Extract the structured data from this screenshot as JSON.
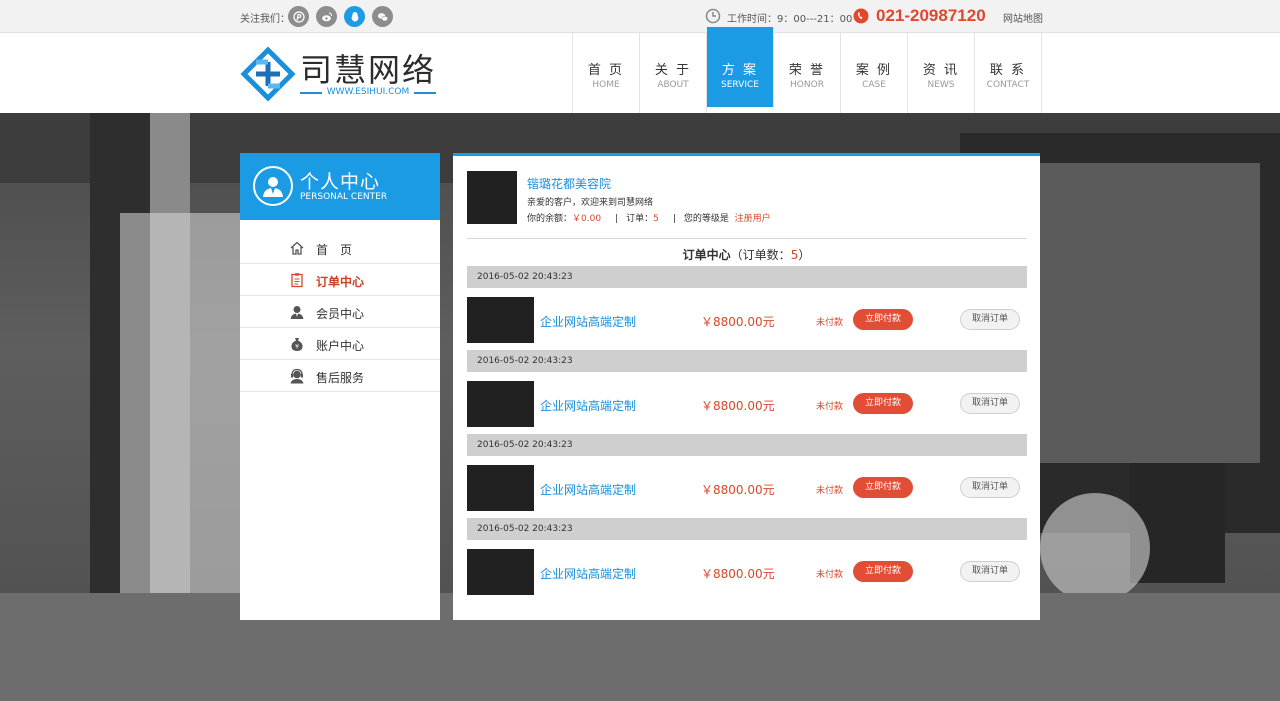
{
  "topbar": {
    "follow_label": "关注我们：",
    "hours": "工作时间：9：00---21：00",
    "phone": "021-20987120",
    "sitemap": "网站地图"
  },
  "header": {
    "logo_text": "司慧网络",
    "logo_url": "WWW.ESIHUI.COM"
  },
  "nav": [
    {
      "zh": "首 页",
      "en": "HOME"
    },
    {
      "zh": "关 于",
      "en": "ABOUT"
    },
    {
      "zh": "方 案",
      "en": "SERVICE"
    },
    {
      "zh": "荣 誉",
      "en": "HONOR"
    },
    {
      "zh": "案 例",
      "en": "CASE"
    },
    {
      "zh": "资 讯",
      "en": "NEWS"
    },
    {
      "zh": "联 系",
      "en": "CONTACT"
    }
  ],
  "sidebar": {
    "title": "个人中心",
    "subtitle": "PERSONAL CENTER",
    "items": [
      {
        "label": "首　页",
        "icon": "home-icon"
      },
      {
        "label": "订单中心",
        "icon": "clipboard-icon"
      },
      {
        "label": "会员中心",
        "icon": "member-icon"
      },
      {
        "label": "账户中心",
        "icon": "money-bag-icon"
      },
      {
        "label": "售后服务",
        "icon": "headset-icon"
      }
    ]
  },
  "profile": {
    "shop_name": "锴璐花都美容院",
    "greeting": "亲爱的客户，欢迎来到司慧网络",
    "balance_label": "你的余额：",
    "balance": "￥0.00",
    "orders_label": "订单：",
    "orders_count": "5",
    "level_label": "您的等级是",
    "level": "注册用户"
  },
  "orders_header": {
    "title": "订单中心",
    "count_prefix": "（订单数：",
    "count": "5",
    "count_suffix": "）"
  },
  "orders": [
    {
      "date": "2016-05-02 20:43:23",
      "name": "企业网站高端定制",
      "price": "￥8800.00元",
      "status": "未付款",
      "pay": "立即付款",
      "cancel": "取消订单"
    },
    {
      "date": "2016-05-02 20:43:23",
      "name": "企业网站高端定制",
      "price": "￥8800.00元",
      "status": "未付款",
      "pay": "立即付款",
      "cancel": "取消订单"
    },
    {
      "date": "2016-05-02 20:43:23",
      "name": "企业网站高端定制",
      "price": "￥8800.00元",
      "status": "未付款",
      "pay": "立即付款",
      "cancel": "取消订单"
    },
    {
      "date": "2016-05-02 20:43:23",
      "name": "企业网站高端定制",
      "price": "￥8800.00元",
      "status": "未付款",
      "pay": "立即付款",
      "cancel": "取消订单"
    }
  ],
  "colors": {
    "accent": "#1a9be4",
    "price_red": "#d9472c",
    "pay_button": "#e24d36"
  }
}
